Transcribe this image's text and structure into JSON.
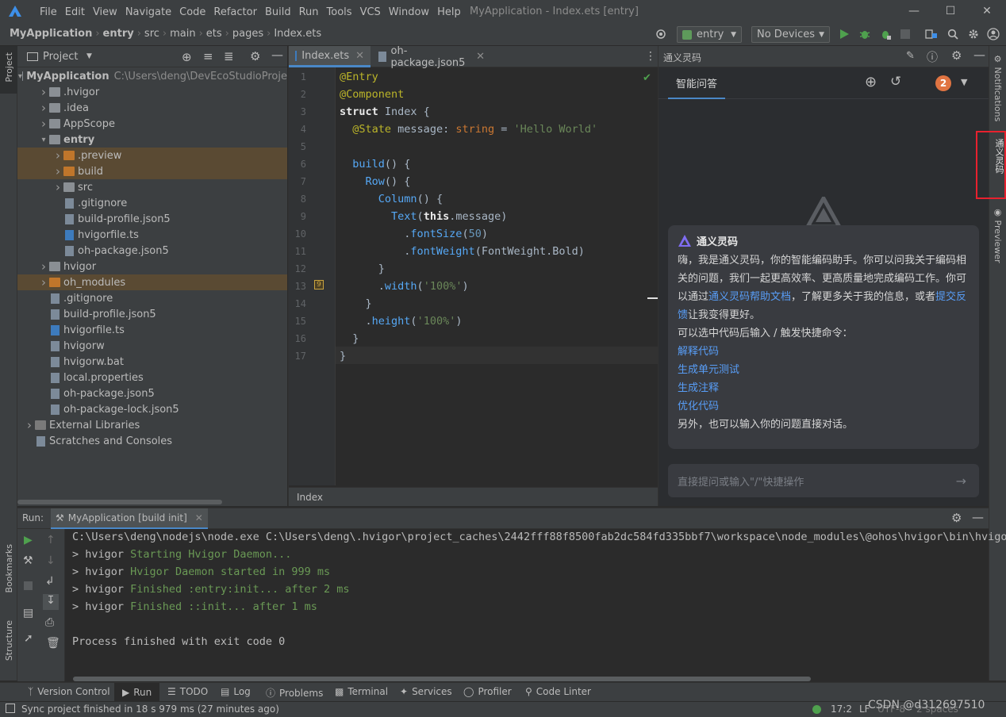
{
  "app": {
    "menus": [
      "File",
      "Edit",
      "View",
      "Navigate",
      "Code",
      "Refactor",
      "Build",
      "Run",
      "Tools",
      "VCS",
      "Window",
      "Help"
    ],
    "window_title": "MyApplication - Index.ets [entry]"
  },
  "navbar": {
    "breadcrumbs": [
      "MyApplication",
      "entry",
      "src",
      "main",
      "ets",
      "pages",
      "Index.ets"
    ],
    "module_combo": "entry",
    "device_combo": "No Devices"
  },
  "left_strip": {
    "project": "Project",
    "bookmarks": "Bookmarks",
    "structure": "Structure"
  },
  "project_panel": {
    "title": "Project",
    "tree": [
      {
        "label": "MyApplication",
        "extra": "C:\\Users\\deng\\DevEcoStudioProje",
        "indent": 0,
        "arrow": "open",
        "icon": "folder",
        "bold": true
      },
      {
        "label": ".hvigor",
        "indent": 1,
        "arrow": "closed",
        "icon": "folder"
      },
      {
        "label": ".idea",
        "indent": 1,
        "arrow": "closed",
        "icon": "folder"
      },
      {
        "label": "AppScope",
        "indent": 1,
        "arrow": "closed",
        "icon": "folder"
      },
      {
        "label": "entry",
        "indent": 1,
        "arrow": "open",
        "icon": "folder",
        "bold": true
      },
      {
        "label": ".preview",
        "indent": 2,
        "arrow": "closed",
        "icon": "folder-orange",
        "selected": true
      },
      {
        "label": "build",
        "indent": 2,
        "arrow": "closed",
        "icon": "folder-orange",
        "selected": true
      },
      {
        "label": "src",
        "indent": 2,
        "arrow": "closed",
        "icon": "folder"
      },
      {
        "label": ".gitignore",
        "indent": 2,
        "arrow": "none",
        "icon": "file"
      },
      {
        "label": "build-profile.json5",
        "indent": 2,
        "arrow": "none",
        "icon": "file"
      },
      {
        "label": "hvigorfile.ts",
        "indent": 2,
        "arrow": "none",
        "icon": "ts"
      },
      {
        "label": "oh-package.json5",
        "indent": 2,
        "arrow": "none",
        "icon": "file"
      },
      {
        "label": "hvigor",
        "indent": 1,
        "arrow": "closed",
        "icon": "folder"
      },
      {
        "label": "oh_modules",
        "indent": 1,
        "arrow": "closed",
        "icon": "folder-orange",
        "selected": true
      },
      {
        "label": ".gitignore",
        "indent": 1,
        "arrow": "none",
        "icon": "file"
      },
      {
        "label": "build-profile.json5",
        "indent": 1,
        "arrow": "none",
        "icon": "file"
      },
      {
        "label": "hvigorfile.ts",
        "indent": 1,
        "arrow": "none",
        "icon": "ts"
      },
      {
        "label": "hvigorw",
        "indent": 1,
        "arrow": "none",
        "icon": "file"
      },
      {
        "label": "hvigorw.bat",
        "indent": 1,
        "arrow": "none",
        "icon": "file"
      },
      {
        "label": "local.properties",
        "indent": 1,
        "arrow": "none",
        "icon": "file"
      },
      {
        "label": "oh-package.json5",
        "indent": 1,
        "arrow": "none",
        "icon": "file"
      },
      {
        "label": "oh-package-lock.json5",
        "indent": 1,
        "arrow": "none",
        "icon": "file"
      },
      {
        "label": "External Libraries",
        "indent": 0,
        "arrow": "closed",
        "icon": "lib"
      },
      {
        "label": "Scratches and Consoles",
        "indent": 0,
        "arrow": "none",
        "icon": "file"
      }
    ]
  },
  "editor": {
    "tabs": [
      "Index.ets",
      "oh-package.json5"
    ],
    "line_numbers": [
      "1",
      "2",
      "3",
      "4",
      "5",
      "6",
      "7",
      "8",
      "9",
      "10",
      "11",
      "12",
      "13",
      "14",
      "15",
      "16",
      "17"
    ],
    "code_lines": [
      "@Entry",
      "@Component",
      "struct Index {",
      "  @State message: string = 'Hello World'",
      "",
      "  build() {",
      "    Row() {",
      "      Column() {",
      "        Text(this.message)",
      "          .fontSize(50)",
      "          .fontWeight(FontWeight.Bold)",
      "      }",
      "      .width('100%')",
      "    }",
      "    .height('100%')",
      "  }",
      "}"
    ],
    "breadcrumb": "Index"
  },
  "ai_panel": {
    "title": "通义灵码",
    "tab": "智能问答",
    "badge": "2",
    "card_title": "通义灵码",
    "intro_a": "嗨，我是通义灵码，你的智能编码助手。你可以问我关于编码相关的问题，我们一起更高效率、更高质量地完成编码工作。你可以通过",
    "intro_link1": "通义灵码帮助文档",
    "intro_b": "，了解更多关于我的信息，或者",
    "intro_link2": "提交反馈",
    "intro_c": "让我变得更好。",
    "shortcut_hint": "可以选中代码后输入 / 触发快捷命令：",
    "commands": [
      "解释代码",
      "生成单元测试",
      "生成注释",
      "优化代码"
    ],
    "closing": "另外，也可以输入你的问题直接对话。",
    "input_placeholder": "直接提问或输入\"/\"快捷操作"
  },
  "right_strip": {
    "notifications": "Notifications",
    "assistant": "通义灵码",
    "previewer": "Previewer"
  },
  "run_panel": {
    "label": "Run:",
    "tab": "MyApplication [build init]",
    "lines": [
      {
        "prefix": "",
        "text": "C:\\Users\\deng\\nodejs\\node.exe C:\\Users\\deng\\.hvigor\\project_caches\\2442fff88f8500fab2dc584fd335bbf7\\workspace\\node_modules\\@ohos\\hvigor\\bin\\hvigo"
      },
      {
        "prefix": "> hvigor ",
        "text": "Starting Hvigor Daemon..."
      },
      {
        "prefix": "> hvigor ",
        "text": "Hvigor Daemon started in 999 ms"
      },
      {
        "prefix": "> hvigor ",
        "text": "Finished :entry:init... after 2 ms"
      },
      {
        "prefix": "> hvigor ",
        "text": "Finished ::init... after 1 ms"
      },
      {
        "prefix": "",
        "text": ""
      },
      {
        "prefix": "",
        "text": "Process finished with exit code 0"
      }
    ]
  },
  "toolwindows": [
    "Version Control",
    "Run",
    "TODO",
    "Log",
    "Problems",
    "Terminal",
    "Services",
    "Profiler",
    "Code Linter"
  ],
  "status": {
    "message": "Sync project finished in 18 s 979 ms (27 minutes ago)",
    "position": "17:2",
    "line_sep": "LF",
    "encoding": "UTF-8",
    "indent": "2 spaces",
    "watermark": "CSDN @d312697510"
  }
}
